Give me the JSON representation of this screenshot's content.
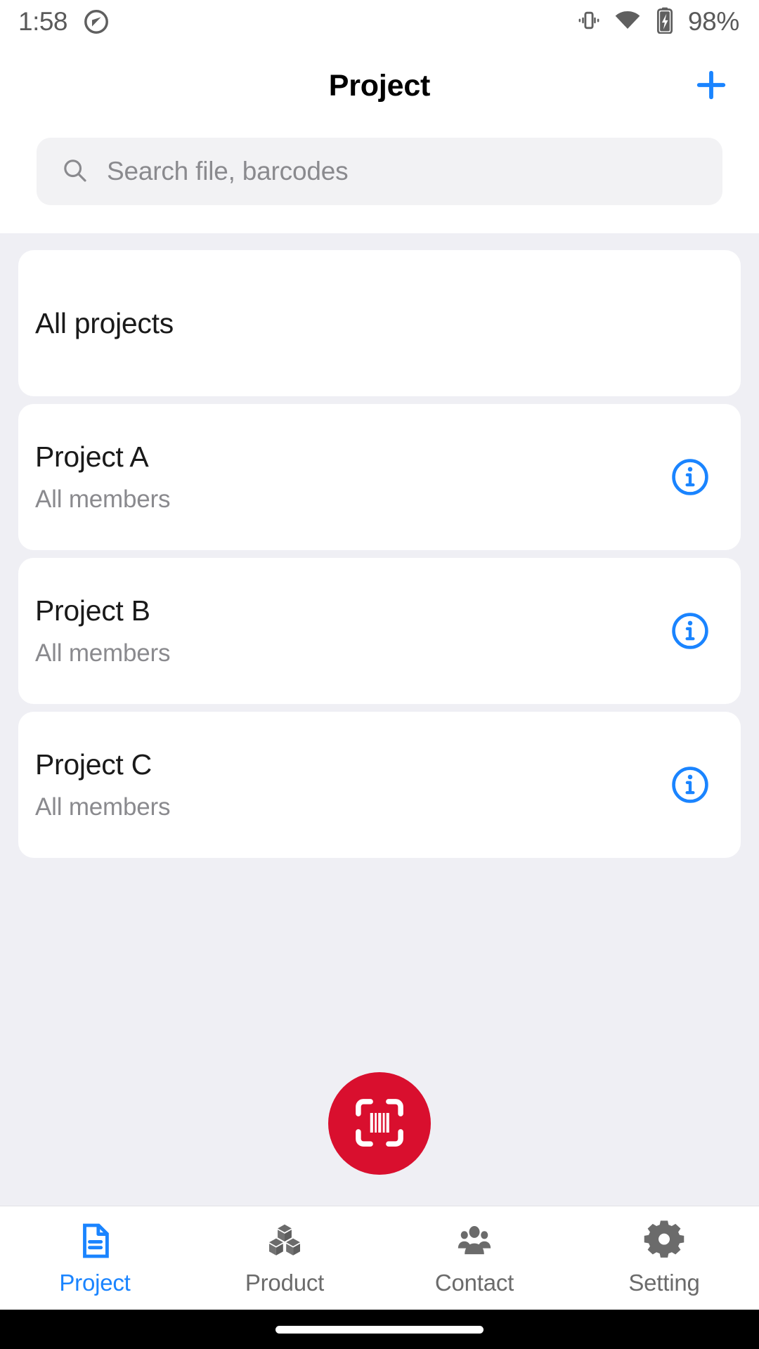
{
  "status_bar": {
    "time": "1:58",
    "left_icon": "data-saver-icon",
    "vibrate_icon": "vibrate-icon",
    "wifi_icon": "wifi-icon",
    "battery_icon": "battery-charging-icon",
    "battery_percent": "98%"
  },
  "header": {
    "title": "Project",
    "add_label": "+",
    "add_icon": "plus-icon",
    "accent_color": "#1a84ff"
  },
  "search": {
    "placeholder": "Search file, barcodes",
    "value": "",
    "icon": "search-icon"
  },
  "project_list": [
    {
      "title": "All projects",
      "subtitle": "",
      "has_info": false,
      "info_icon": ""
    },
    {
      "title": "Project A",
      "subtitle": "All members",
      "has_info": true,
      "info_icon": "info-circle-icon"
    },
    {
      "title": "Project B",
      "subtitle": "All members",
      "has_info": true,
      "info_icon": "info-circle-icon"
    },
    {
      "title": "Project C",
      "subtitle": "All members",
      "has_info": true,
      "info_icon": "info-circle-icon"
    }
  ],
  "scan_button": {
    "icon": "barcode-scan-icon",
    "color": "#d90f2e"
  },
  "bottom_nav": {
    "active_color": "#1a84ff",
    "inactive_color": "#6b6b6b",
    "items": [
      {
        "label": "Project",
        "icon": "document-icon",
        "active": true
      },
      {
        "label": "Product",
        "icon": "boxes-icon",
        "active": false
      },
      {
        "label": "Contact",
        "icon": "people-icon",
        "active": false
      },
      {
        "label": "Setting",
        "icon": "gear-icon",
        "active": false
      }
    ]
  }
}
